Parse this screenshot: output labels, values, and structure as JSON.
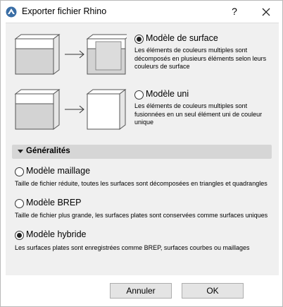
{
  "window": {
    "title": "Exporter fichier Rhino",
    "help_label": "?"
  },
  "surface_options": [
    {
      "label": "Modèle de surface",
      "checked": true,
      "description": [
        "Les éléments de couleurs multiples sont",
        "décomposés en plusieurs éléments selon leurs",
        "couleurs de surface"
      ]
    },
    {
      "label": "Modèle uni",
      "checked": false,
      "description": [
        "Les éléments de couleurs multiples sont",
        "fusionnées en un seul élément uni de couleur",
        "unique"
      ]
    }
  ],
  "general_section": {
    "title": "Généralités",
    "options": [
      {
        "label": "Modèle maillage",
        "checked": false,
        "description": "Taille de fichier réduite, toutes les surfaces sont décomposées en triangles et quadrangles"
      },
      {
        "label": "Modèle BREP",
        "checked": false,
        "description": "Taille de fichier plus grande, les surfaces plates sont conservées comme surfaces uniques"
      },
      {
        "label": "Modèle hybride",
        "checked": true,
        "description": "Les surfaces plates sont enregistrées comme BREP, surfaces courbes ou maillages"
      }
    ]
  },
  "buttons": {
    "cancel": "Annuler",
    "ok": "OK"
  },
  "colors": {
    "panel_bg": "#f0f0f0",
    "section_bar": "#d6d6d6",
    "box_fill_light": "#ffffff",
    "box_fill_dark": "#d3d3d3"
  }
}
